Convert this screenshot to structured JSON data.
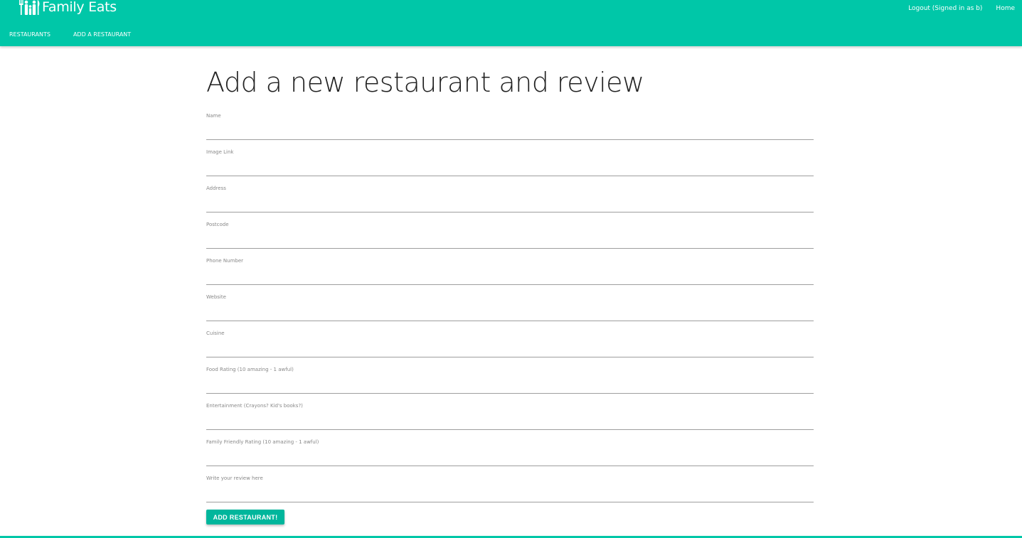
{
  "brand": {
    "name": "Family Eats",
    "icon": "family-icon"
  },
  "top_links": [
    {
      "label": "Logout (Signed in as b)"
    },
    {
      "label": "Home"
    }
  ],
  "subnav": [
    {
      "label": "RESTAURANTS"
    },
    {
      "label": "ADD A RESTAURANT"
    }
  ],
  "page_title": "Add a new restaurant and review",
  "form": {
    "fields": [
      {
        "label": "Name",
        "value": ""
      },
      {
        "label": "Image Link",
        "value": ""
      },
      {
        "label": "Address",
        "value": ""
      },
      {
        "label": "Postcode",
        "value": ""
      },
      {
        "label": "Phone Number",
        "value": ""
      },
      {
        "label": "Website",
        "value": ""
      },
      {
        "label": "Cuisine",
        "value": ""
      },
      {
        "label": "Food Rating (10 amazing - 1 awful)",
        "value": ""
      },
      {
        "label": "Entertainment (Crayons? Kid's books?)",
        "value": ""
      },
      {
        "label": "Family Friendly Rating (10 amazing - 1 awful)",
        "value": ""
      },
      {
        "label": "Write your review here",
        "value": ""
      }
    ],
    "submit_label": "ADD RESTAURANT!"
  },
  "colors": {
    "accent": "#00c7a8",
    "button": "#00b69c"
  }
}
